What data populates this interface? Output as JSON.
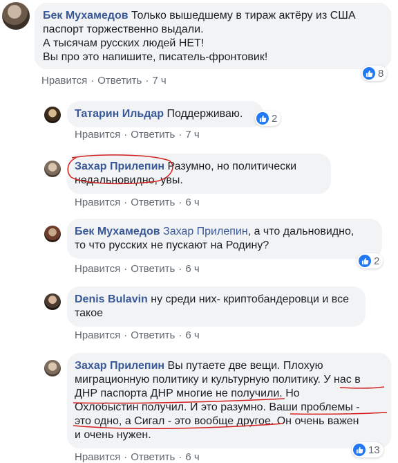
{
  "actions": {
    "like": "Нравится",
    "reply": "Ответить",
    "sep": "·"
  },
  "comments": [
    {
      "author": "Бек Мухамедов",
      "lines": [
        "Только вышедшему в тираж актёру из США",
        "паспорт торжественно выдали.",
        "А тысячам русских людей НЕТ!",
        "Вы про это напишите, писатель-фронтовик!"
      ],
      "likes": "8",
      "time": "7 ч"
    },
    {
      "author": "Татарин Ильдар",
      "text": "Поддерживаю.",
      "likes": "2",
      "time": "7 ч"
    },
    {
      "author": "Захар Прилепин",
      "text1": "Разумно, но политически",
      "text2": "недальновидно, увы.",
      "time": "6 ч"
    },
    {
      "author": "Бек Мухамедов",
      "mention": "Захар Прилепин",
      "text1": ", а что дальновидно,",
      "text2": "то что русских не пускают на Родину?",
      "likes": "2",
      "time": "6 ч"
    },
    {
      "author": "Denis Bulavin",
      "text1": "ну среди них- криптобандеровци и все",
      "text2": "такое",
      "time": "6 ч"
    },
    {
      "author": "Захар Прилепин",
      "text1": "Вы путаете две вещи. Плохую",
      "lines": [
        "миграционную политику и культурную политику. У нас в",
        "ДНР паспорта ДНР многие не получили. Но",
        "Охлобыстин получил. И это разумно. Ваши проблемы -",
        "это одно, а Сигал - это вообще другое. Он очень важен",
        "и очень нужен."
      ],
      "likes": "13",
      "time": "6 ч"
    }
  ]
}
